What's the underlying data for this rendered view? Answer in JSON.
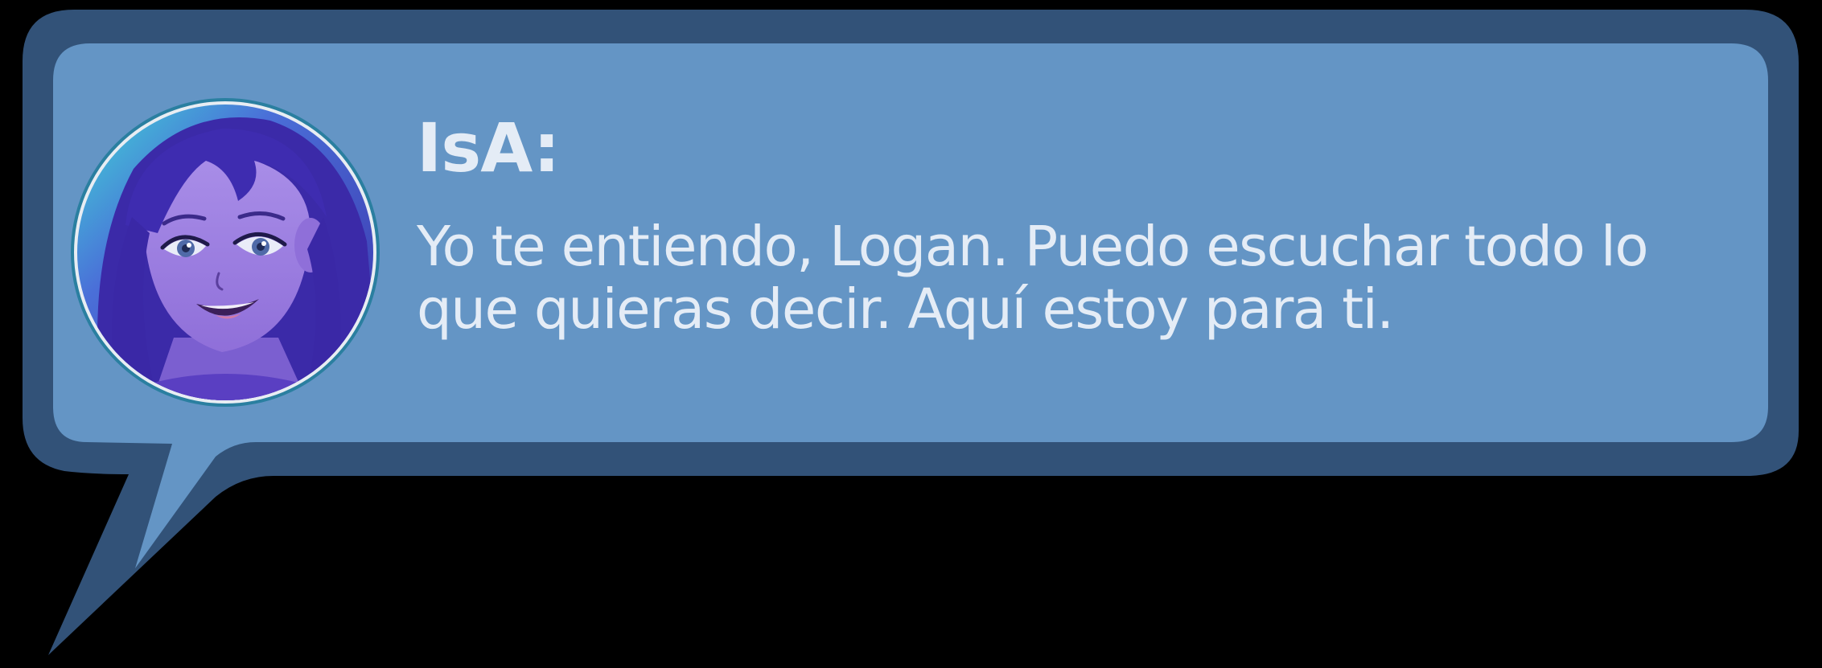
{
  "dialog": {
    "speaker": "IsA:",
    "message": "Yo te entiendo, Logan. Puedo escuchar todo lo que quieras decir. Aquí estoy para ti."
  },
  "avatar": {
    "icon": "character-portrait-icon"
  },
  "colors": {
    "background": "#000000",
    "bubble_border": "#325278",
    "bubble_fill": "#6495c5",
    "text": "#e4ecf6",
    "avatar_ring": "#e8edf3",
    "avatar_ring_outer": "#2a7fa0"
  }
}
